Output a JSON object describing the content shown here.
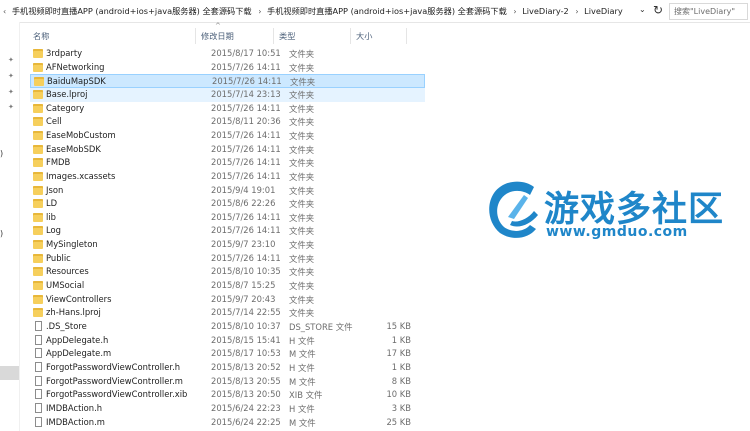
{
  "address_bar": {
    "crumbs": [
      "手机视频即时直播APP (android+ios+java服务器) 全套源码下载",
      "手机视频即时直播APP (android+ios+java服务器) 全套源码下载",
      "LiveDiary-2",
      "LiveDiary"
    ],
    "search_placeholder": "搜索\"LiveDiary\""
  },
  "columns": {
    "name": "名称",
    "date": "修改日期",
    "type": "类型",
    "size": "大小"
  },
  "files": [
    {
      "name": "3rdparty",
      "date": "2015/8/17 10:51",
      "type": "文件夹",
      "size": "",
      "kind": "folder"
    },
    {
      "name": "AFNetworking",
      "date": "2015/7/26 14:11",
      "type": "文件夹",
      "size": "",
      "kind": "folder"
    },
    {
      "name": "BaiduMapSDK",
      "date": "2015/7/26 14:11",
      "type": "文件夹",
      "size": "",
      "kind": "folder",
      "state": "selected"
    },
    {
      "name": "Base.lproj",
      "date": "2015/7/14 23:13",
      "type": "文件夹",
      "size": "",
      "kind": "folder",
      "state": "hover"
    },
    {
      "name": "Category",
      "date": "2015/7/26 14:11",
      "type": "文件夹",
      "size": "",
      "kind": "folder"
    },
    {
      "name": "Cell",
      "date": "2015/8/11 20:36",
      "type": "文件夹",
      "size": "",
      "kind": "folder"
    },
    {
      "name": "EaseMobCustom",
      "date": "2015/7/26 14:11",
      "type": "文件夹",
      "size": "",
      "kind": "folder"
    },
    {
      "name": "EaseMobSDK",
      "date": "2015/7/26 14:11",
      "type": "文件夹",
      "size": "",
      "kind": "folder"
    },
    {
      "name": "FMDB",
      "date": "2015/7/26 14:11",
      "type": "文件夹",
      "size": "",
      "kind": "folder"
    },
    {
      "name": "Images.xcassets",
      "date": "2015/7/26 14:11",
      "type": "文件夹",
      "size": "",
      "kind": "folder"
    },
    {
      "name": "Json",
      "date": "2015/9/4 19:01",
      "type": "文件夹",
      "size": "",
      "kind": "folder"
    },
    {
      "name": "LD",
      "date": "2015/8/6 22:26",
      "type": "文件夹",
      "size": "",
      "kind": "folder"
    },
    {
      "name": "lib",
      "date": "2015/7/26 14:11",
      "type": "文件夹",
      "size": "",
      "kind": "folder"
    },
    {
      "name": "Log",
      "date": "2015/7/26 14:11",
      "type": "文件夹",
      "size": "",
      "kind": "folder"
    },
    {
      "name": "MySingleton",
      "date": "2015/9/7 23:10",
      "type": "文件夹",
      "size": "",
      "kind": "folder"
    },
    {
      "name": "Public",
      "date": "2015/7/26 14:11",
      "type": "文件夹",
      "size": "",
      "kind": "folder"
    },
    {
      "name": "Resources",
      "date": "2015/8/10 10:35",
      "type": "文件夹",
      "size": "",
      "kind": "folder"
    },
    {
      "name": "UMSocial",
      "date": "2015/8/7 15:25",
      "type": "文件夹",
      "size": "",
      "kind": "folder"
    },
    {
      "name": "ViewControllers",
      "date": "2015/9/7 20:43",
      "type": "文件夹",
      "size": "",
      "kind": "folder"
    },
    {
      "name": "zh-Hans.lproj",
      "date": "2015/7/14 22:55",
      "type": "文件夹",
      "size": "",
      "kind": "folder"
    },
    {
      "name": ".DS_Store",
      "date": "2015/8/10 10:37",
      "type": "DS_STORE 文件",
      "size": "15 KB",
      "kind": "file"
    },
    {
      "name": "AppDelegate.h",
      "date": "2015/8/15 15:41",
      "type": "H 文件",
      "size": "1 KB",
      "kind": "file"
    },
    {
      "name": "AppDelegate.m",
      "date": "2015/8/17 10:53",
      "type": "M 文件",
      "size": "17 KB",
      "kind": "file"
    },
    {
      "name": "ForgotPasswordViewController.h",
      "date": "2015/8/13 20:52",
      "type": "H 文件",
      "size": "1 KB",
      "kind": "file"
    },
    {
      "name": "ForgotPasswordViewController.m",
      "date": "2015/8/13 20:55",
      "type": "M 文件",
      "size": "8 KB",
      "kind": "file"
    },
    {
      "name": "ForgotPasswordViewController.xib",
      "date": "2015/8/13 20:50",
      "type": "XIB 文件",
      "size": "10 KB",
      "kind": "file"
    },
    {
      "name": "IMDBAction.h",
      "date": "2015/6/24 22:23",
      "type": "H 文件",
      "size": "3 KB",
      "kind": "file"
    },
    {
      "name": "IMDBAction.m",
      "date": "2015/6/24 22:25",
      "type": "M 文件",
      "size": "25 KB",
      "kind": "file"
    }
  ],
  "watermark": {
    "title": "游戏多社区",
    "url": "www.gmduo.com"
  },
  "colors": {
    "accent": "#1f86c9",
    "selected_bg": "#cce8ff",
    "hover_bg": "#e5f3ff",
    "folder": "#f6cf5c"
  }
}
